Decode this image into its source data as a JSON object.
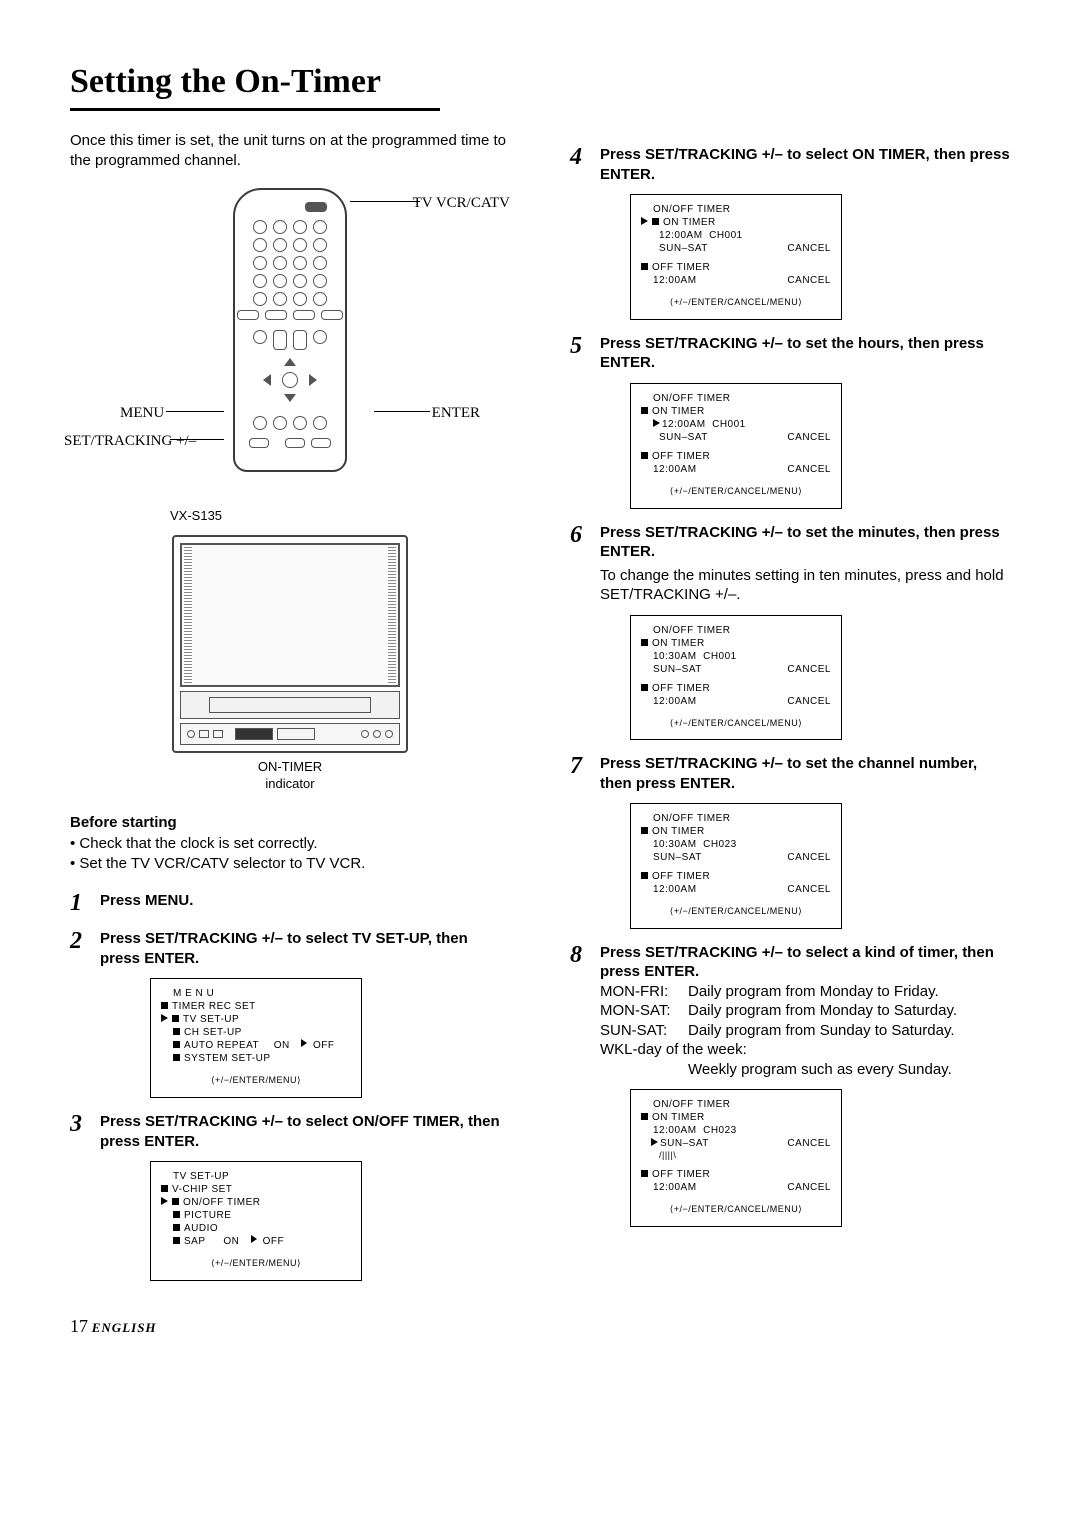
{
  "title": "Setting the On-Timer",
  "intro": "Once this timer is set, the unit turns on at the programmed time to the programmed channel.",
  "remote": {
    "top_label": "TV VCR/CATV",
    "left_label_1": "MENU",
    "left_label_2": "SET/TRACKING +/–",
    "right_label": "ENTER"
  },
  "tv": {
    "model": "VX-S135",
    "caption1": "ON-TIMER",
    "caption2": "indicator"
  },
  "before": {
    "heading": "Before starting",
    "b1": "Check that the clock is set correctly.",
    "b2": "Set the TV VCR/CATV selector to TV VCR."
  },
  "steps": {
    "s1": "Press MENU.",
    "s2": "Press SET/TRACKING +/– to select TV SET-UP, then press ENTER.",
    "s3": "Press SET/TRACKING +/– to select ON/OFF TIMER, then press ENTER.",
    "s4": "Press SET/TRACKING +/– to select ON TIMER, then press ENTER.",
    "s5": "Press SET/TRACKING +/– to set the hours, then press ENTER.",
    "s6": "Press SET/TRACKING +/– to set the minutes, then press ENTER.",
    "s6_note": "To change the minutes setting in ten minutes, press and hold SET/TRACKING +/–.",
    "s7": "Press SET/TRACKING +/– to set the channel number, then press ENTER.",
    "s8": "Press SET/TRACKING +/– to select a kind of timer, then press ENTER.",
    "s8_opts": [
      {
        "k": "MON-FRI:",
        "v": "Daily program from Monday to Friday."
      },
      {
        "k": "MON-SAT:",
        "v": "Daily program from Monday to Saturday."
      },
      {
        "k": "SUN-SAT:",
        "v": "Daily program from Sunday to Saturday."
      },
      {
        "k": "WKL-day of the week:",
        "v": ""
      }
    ],
    "s8_wkl_note": "Weekly program such as every Sunday."
  },
  "osd2": {
    "title": "M E N U",
    "i1": "TIMER REC SET",
    "i2": "TV SET-UP",
    "i3": "CH SET-UP",
    "i4_l": "AUTO REPEAT",
    "i4_m": "ON",
    "i4_r": "OFF",
    "i5": "SYSTEM SET-UP",
    "foot": "⟨+/−/ENTER/MENU⟩"
  },
  "osd3": {
    "title": "TV SET-UP",
    "i1": "V-CHIP SET",
    "i2": "ON/OFF TIMER",
    "i3": "PICTURE",
    "i4": "AUDIO",
    "i5_l": "SAP",
    "i5_m": "ON",
    "i5_r": "OFF",
    "foot": "⟨+/−/ENTER/MENU⟩"
  },
  "osd_right": {
    "title": "ON/OFF TIMER",
    "on": "ON TIMER",
    "off": "OFF TIMER",
    "off_time": "12:00AM",
    "cancel": "CANCEL",
    "foot": "⟨+/−/ENTER/CANCEL/MENU⟩",
    "s4_time": "12:00AM",
    "s4_ch": "CH001",
    "s4_day": "SUN–SAT",
    "s5_time": "12:00AM",
    "s5_ch": "CH001",
    "s5_day": "SUN–SAT",
    "s6_time": "10:30AM",
    "s6_ch": "CH001",
    "s6_day": "SUN–SAT",
    "s7_time": "10:30AM",
    "s7_ch": "CH023",
    "s7_day": "SUN–SAT",
    "s8_time": "12:00AM",
    "s8_ch": "CH023",
    "s8_day": "SUN–SAT"
  },
  "footer": {
    "page": "17",
    "lang": "ENGLISH"
  }
}
